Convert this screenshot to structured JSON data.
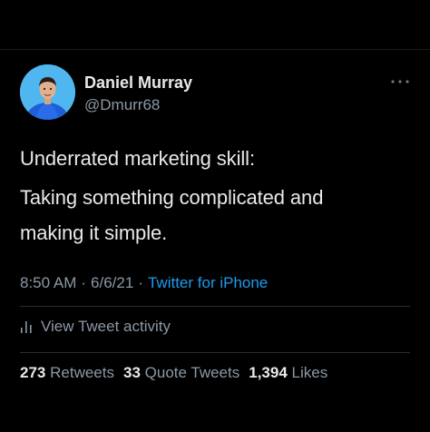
{
  "author": {
    "display_name": "Daniel Murray",
    "handle": "@Dmurr68",
    "avatar_icon": "profile-photo"
  },
  "tweet": {
    "lines": [
      "Underrated marketing skill:",
      "Taking something complicated and",
      "making it simple."
    ]
  },
  "meta": {
    "time": "8:50 AM",
    "separator": "·",
    "date": "6/6/21",
    "source": "Twitter for iPhone"
  },
  "activity": {
    "label": "View Tweet activity",
    "icon": "bar-chart-icon"
  },
  "stats": {
    "retweets_count": "273",
    "retweets_label": "Retweets",
    "quotes_count": "33",
    "quotes_label": "Quote Tweets",
    "likes_count": "1,394",
    "likes_label": "Likes"
  },
  "colors": {
    "background": "#000000",
    "text_primary": "#e7e9ea",
    "text_secondary": "#8b98a5",
    "link": "#1d9bf0",
    "avatar_bg": "#4fb6f0"
  }
}
